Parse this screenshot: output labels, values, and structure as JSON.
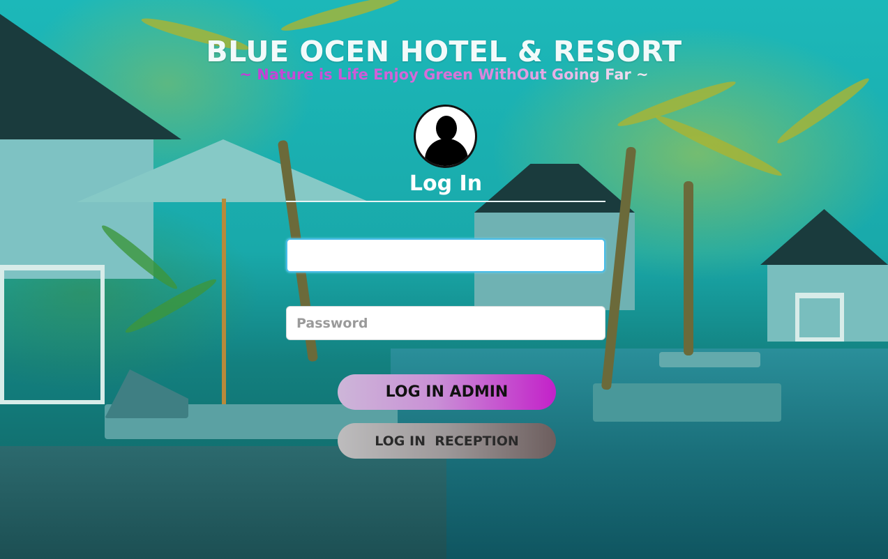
{
  "header": {
    "title": "BLUE OCEN HOTEL & RESORT",
    "subtitle": "~ Nature is Life Enjoy Green WithOut Going Far ~"
  },
  "login": {
    "heading": "Log In",
    "username_value": "",
    "username_placeholder": "",
    "password_placeholder": "Password",
    "admin_button": "LOG IN ADMIN",
    "reception_button": "LOG IN  RECEPTION"
  },
  "icons": {
    "avatar": "user-avatar-icon"
  },
  "colors": {
    "title": "#f2fafa",
    "subtitle_start": "#c23ad6",
    "admin_button_end": "#c321c9",
    "background": "#1fb2b4"
  }
}
